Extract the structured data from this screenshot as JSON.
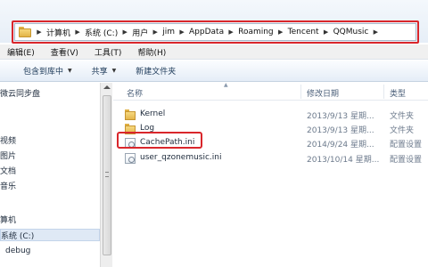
{
  "address_bar": {
    "crumbs": [
      "计算机",
      "系统 (C:)",
      "用户",
      "jim",
      "AppData",
      "Roaming",
      "Tencent",
      "QQMusic"
    ]
  },
  "menu": [
    "编辑(E)",
    "查看(V)",
    "工具(T)",
    "帮助(H)"
  ],
  "toolbar": {
    "include_library": "包含到库中",
    "share": "共享",
    "new_folder": "新建文件夹"
  },
  "nav": {
    "items": [
      "微云同步盘",
      "视频",
      "图片",
      "文档",
      "音乐",
      "算机",
      "系统 (C:)",
      "debug"
    ]
  },
  "columns": {
    "name": "名称",
    "date": "修改日期",
    "type": "类型"
  },
  "files": [
    {
      "name": "Kernel",
      "date": "2013/9/13 星期...",
      "type": "文件夹",
      "icon": "folder-icon"
    },
    {
      "name": "Log",
      "date": "2013/9/13 星期...",
      "type": "文件夹",
      "icon": "folder-icon"
    },
    {
      "name": "CachePath.ini",
      "date": "2014/9/24 星期...",
      "type": "配置设置",
      "icon": "settings-file-icon"
    },
    {
      "name": "user_qzonemusic.ini",
      "date": "2013/10/14 星期...",
      "type": "配置设置",
      "icon": "settings-file-icon"
    }
  ],
  "colors": {
    "highlight_frame": "#d9262b"
  }
}
